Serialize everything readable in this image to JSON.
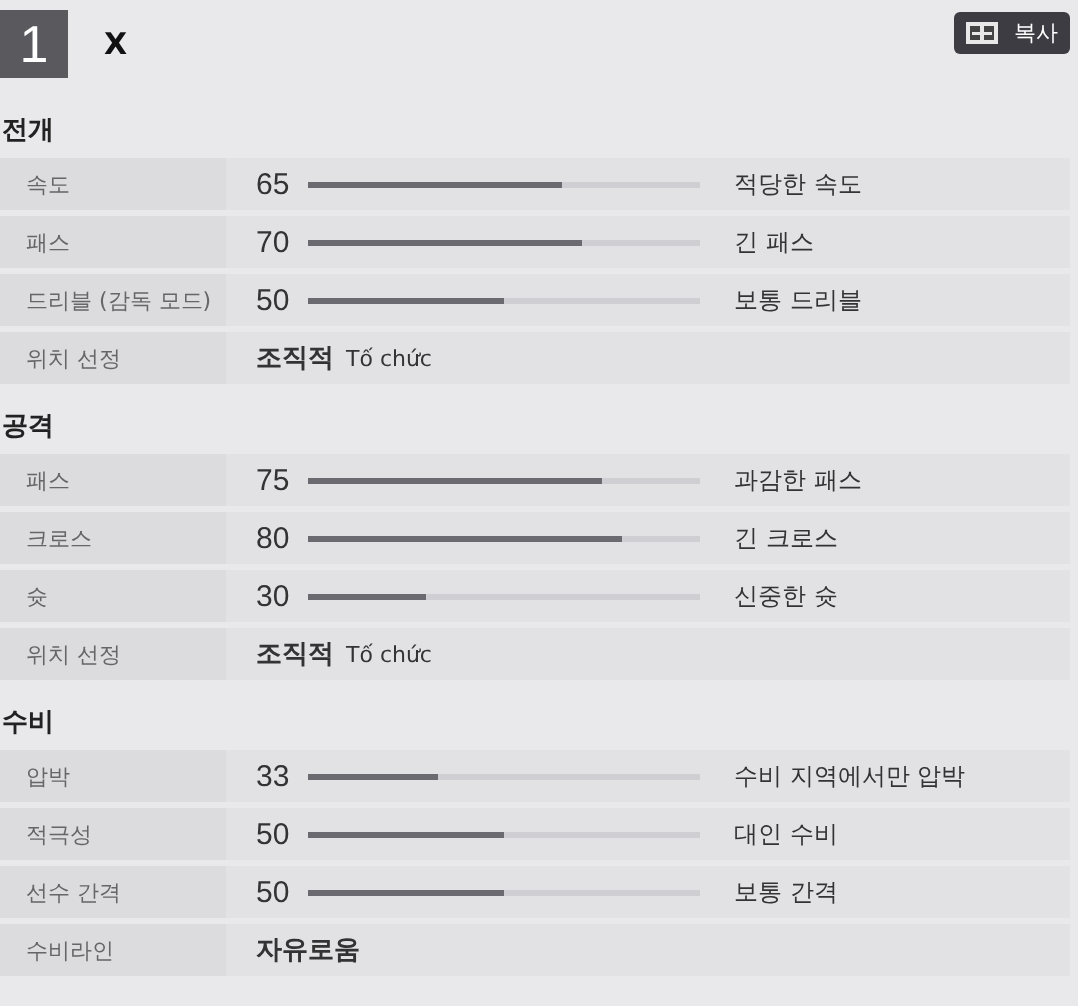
{
  "header": {
    "number": "1",
    "title": "X",
    "copy_button": "복사"
  },
  "sections": [
    {
      "title": "전개",
      "rows": [
        {
          "kind": "slider",
          "label": "속도",
          "reading": "65",
          "level": 0.65,
          "description": "적당한 속도"
        },
        {
          "kind": "slider",
          "label": "패스",
          "reading": "70",
          "level": 0.7,
          "description": "긴 패스"
        },
        {
          "kind": "slider",
          "label": "드리블 (감독 모드)",
          "reading": "50",
          "level": 0.5,
          "description": "보통 드리블"
        },
        {
          "kind": "text",
          "label": "위치 선정",
          "value": "조직적",
          "note": "Tố chức"
        }
      ]
    },
    {
      "title": "공격",
      "rows": [
        {
          "kind": "slider",
          "label": "패스",
          "reading": "75",
          "level": 0.75,
          "description": "과감한 패스"
        },
        {
          "kind": "slider",
          "label": "크로스",
          "reading": "80",
          "level": 0.8,
          "description": "긴 크로스"
        },
        {
          "kind": "slider",
          "label": "슛",
          "reading": "30",
          "level": 0.3,
          "description": "신중한 슛"
        },
        {
          "kind": "text",
          "label": "위치 선정",
          "value": "조직적",
          "note": "Tố chức"
        }
      ]
    },
    {
      "title": "수비",
      "rows": [
        {
          "kind": "slider",
          "label": "압박",
          "reading": "33",
          "level": 0.33,
          "description": "수비 지역에서만 압박"
        },
        {
          "kind": "slider",
          "label": "적극성",
          "reading": "50",
          "level": 0.5,
          "description": "대인 수비"
        },
        {
          "kind": "slider",
          "label": "선수 간격",
          "reading": "50",
          "level": 0.5,
          "description": "보통 간격"
        },
        {
          "kind": "text",
          "label": "수비라인",
          "value": "자유로움"
        }
      ]
    }
  ]
}
